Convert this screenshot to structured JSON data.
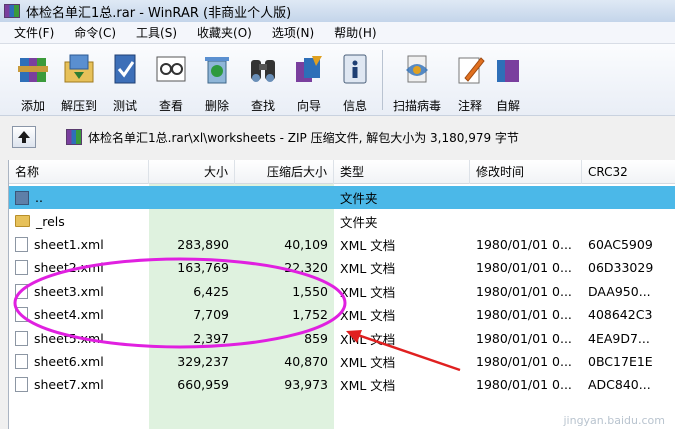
{
  "window": {
    "title": "体检名单汇1总.rar - WinRAR (非商业个人版)"
  },
  "menu": [
    "文件(F)",
    "命令(C)",
    "工具(S)",
    "收藏夹(O)",
    "选项(N)",
    "帮助(H)"
  ],
  "toolbar": [
    {
      "label": "添加",
      "icon": "add-archive-icon"
    },
    {
      "label": "解压到",
      "icon": "extract-to-icon"
    },
    {
      "label": "测试",
      "icon": "test-icon"
    },
    {
      "label": "查看",
      "icon": "view-icon"
    },
    {
      "label": "删除",
      "icon": "delete-icon"
    },
    {
      "label": "查找",
      "icon": "find-icon"
    },
    {
      "label": "向导",
      "icon": "wizard-icon"
    },
    {
      "label": "信息",
      "icon": "info-icon"
    },
    {
      "label": "扫描病毒",
      "icon": "virus-scan-icon"
    },
    {
      "label": "注释",
      "icon": "comment-icon"
    },
    {
      "label": "自解",
      "icon": "sfx-icon"
    }
  ],
  "address": {
    "path": "体检名单汇1总.rar\\xl\\worksheets - ZIP 压缩文件, 解包大小为 3,180,979 字节"
  },
  "columns": {
    "name": "名称",
    "size": "大小",
    "packed": "压缩后大小",
    "type": "类型",
    "modified": "修改时间",
    "crc": "CRC32"
  },
  "rows": [
    {
      "name": "..",
      "size": "",
      "packed": "",
      "type": "文件夹",
      "modified": "",
      "crc": "",
      "kind": "up"
    },
    {
      "name": "_rels",
      "size": "",
      "packed": "",
      "type": "文件夹",
      "modified": "",
      "crc": "",
      "kind": "folder"
    },
    {
      "name": "sheet1.xml",
      "size": "283,890",
      "packed": "40,109",
      "type": "XML 文档",
      "modified": "1980/01/01 0...",
      "crc": "60AC5909",
      "kind": "file"
    },
    {
      "name": "sheet2.xml",
      "size": "163,769",
      "packed": "22,320",
      "type": "XML 文档",
      "modified": "1980/01/01 0...",
      "crc": "06D33029",
      "kind": "file"
    },
    {
      "name": "sheet3.xml",
      "size": "6,425",
      "packed": "1,550",
      "type": "XML 文档",
      "modified": "1980/01/01 0...",
      "crc": "DAA950...",
      "kind": "file"
    },
    {
      "name": "sheet4.xml",
      "size": "7,709",
      "packed": "1,752",
      "type": "XML 文档",
      "modified": "1980/01/01 0...",
      "crc": "408642C3",
      "kind": "file"
    },
    {
      "name": "sheet5.xml",
      "size": "2,397",
      "packed": "859",
      "type": "XML 文档",
      "modified": "1980/01/01 0...",
      "crc": "4EA9D7...",
      "kind": "file"
    },
    {
      "name": "sheet6.xml",
      "size": "329,237",
      "packed": "40,870",
      "type": "XML 文档",
      "modified": "1980/01/01 0...",
      "crc": "0BC17E1E",
      "kind": "file"
    },
    {
      "name": "sheet7.xml",
      "size": "660,959",
      "packed": "93,973",
      "type": "XML 文档",
      "modified": "1980/01/01 0...",
      "crc": "ADC840...",
      "kind": "file"
    }
  ],
  "annotation": {
    "ellipse_color": "#e020e0",
    "arrow_color": "#e02020"
  },
  "watermark": "jingyan.baidu.com"
}
